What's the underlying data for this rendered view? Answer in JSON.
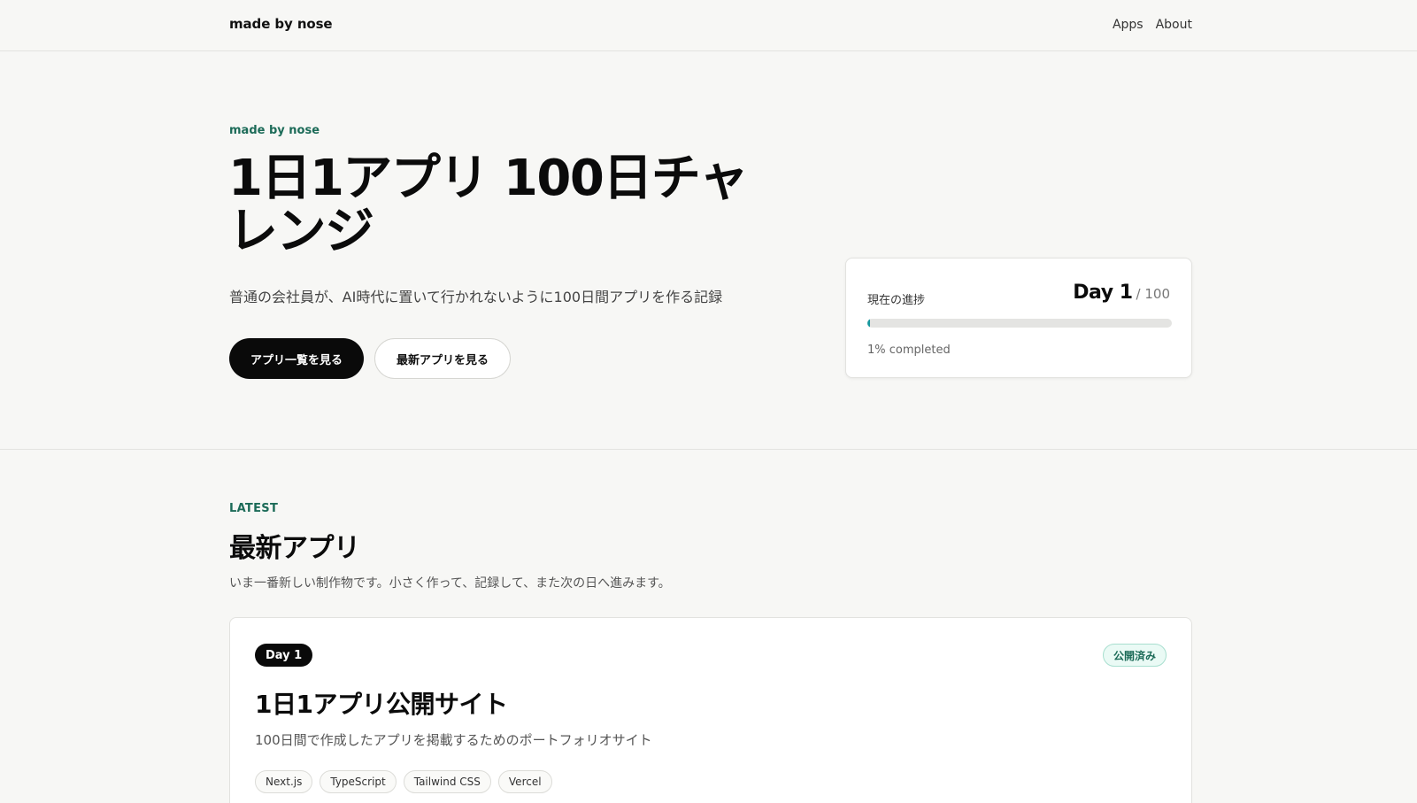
{
  "header": {
    "brand": "made by nose",
    "nav": [
      {
        "label": "Apps"
      },
      {
        "label": "About"
      }
    ]
  },
  "hero": {
    "eyebrow": "made by nose",
    "title": "1日1アプリ 100日チャレンジ",
    "subtitle": "普通の会社員が、AI時代に置いて行かれないように100日間アプリを作る記録",
    "primary_button": "アプリ一覧を見る",
    "secondary_button": "最新アプリを見る"
  },
  "progress": {
    "label": "現在の進捗",
    "day_label": "Day 1",
    "day_total": "/ 100",
    "percent": 1,
    "status_text": "1% completed",
    "bar_color": "#1a9aa0"
  },
  "latest": {
    "eyebrow": "LATEST",
    "title": "最新アプリ",
    "subtitle": "いま一番新しい制作物です。小さく作って、記録して、また次の日へ進みます。",
    "app": {
      "day_badge": "Day 1",
      "status_badge": "公開済み",
      "title": "1日1アプリ公開サイト",
      "description": "100日間で作成したアプリを掲載するためのポートフォリオサイト",
      "tags": [
        "Next.js",
        "TypeScript",
        "Tailwind CSS",
        "Vercel"
      ]
    }
  },
  "colors": {
    "accent": "#1c6b58",
    "background": "#f7f7f5",
    "primary_button": "#0a0a0a"
  }
}
